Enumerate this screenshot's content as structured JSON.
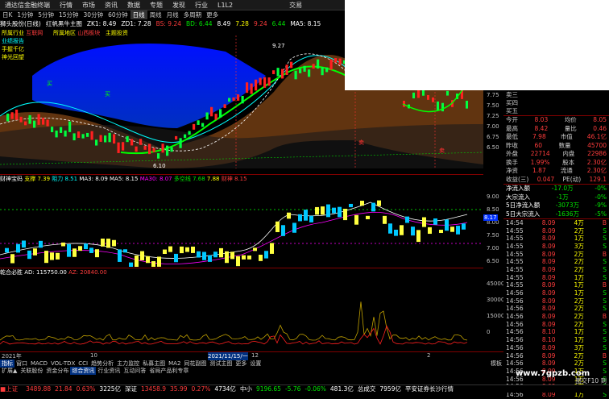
{
  "menu": {
    "logo": "通达信金融终端",
    "items": [
      "行情",
      "市场",
      "资讯",
      "数据",
      "专题",
      "发现",
      "行业",
      "L1L2"
    ],
    "trade": "交易",
    "window_ctrl": "■"
  },
  "timeframes": {
    "items": [
      "日K",
      "1分钟",
      "5分钟",
      "15分钟",
      "30分钟",
      "60分钟",
      "日线",
      "周线",
      "月线",
      "多周期",
      "更多"
    ],
    "active": 6
  },
  "info": {
    "stock": "狮头股份(日线)",
    "indicator": "红帆黑牛主图",
    "zk": "ZK1: 8.49",
    "zd": "ZD1: 7.28",
    "bs": "BS: 9.24",
    "bd": "BD: 6.44",
    "r1": "8.49",
    "r2": "7.28",
    "r3": "9.24",
    "r4": "6.44",
    "ma5": "MA5: 8.15"
  },
  "tags": {
    "industry_lbl": "所属行业",
    "industry": "互联网",
    "region_lbl": "所属地区",
    "region": "山西板块",
    "theme_lbl": "主题投资",
    "t1": "业绩报告",
    "t2": "手握千亿",
    "t3": "神光回望"
  },
  "main_axis": {
    "ticks": [
      "7.75",
      "7.50",
      "7.25",
      "7.00",
      "6.75",
      "6.50"
    ]
  },
  "markers": {
    "buy": "买",
    "sell": "卖",
    "peak": "9.27",
    "low": "6.10"
  },
  "sub1": {
    "name": "财神宝码",
    "zhicheng": "支撑 7.39",
    "yali": "阻力 8.51",
    "ma3": "MA3: 8.09",
    "ma5": "MA5: 8.15",
    "ma30": "MA30: 8.07",
    "extra": "多空线 7.68",
    "extra2": "7.88",
    "extra3": "财神 8.15",
    "axis": [
      "9.00",
      "8.50",
      "8.00",
      "7.50",
      "7.00",
      "6.50"
    ],
    "price_tag": "8.17"
  },
  "sub2": {
    "name": "乾合必胜",
    "ad": "AD: 115750.00",
    "az": "AZ: 20840.00",
    "axis": [
      "45000",
      "30000",
      "15000",
      "0"
    ]
  },
  "dates": {
    "d1": "2021年",
    "d2": "10",
    "d3": "2021/11/15/一",
    "d4": "12",
    "d5": "2"
  },
  "tabs_row1": {
    "items": [
      "指标",
      "窗口",
      "MACD",
      "VOL-TDX",
      "CCI",
      "趋势分析",
      "主力监控",
      "私募主图",
      "MA2",
      "同花副图",
      "测试主图",
      "更多",
      "设置"
    ],
    "active": 0,
    "right": "模板"
  },
  "tabs_row2": {
    "items": [
      "扩展▲",
      "关联股份",
      "资金分布",
      "综合资讯",
      "行业资讯",
      "互动问答",
      "省局产品利专章"
    ],
    "active": 3
  },
  "quote": {
    "sell3_lbl": "卖三",
    "sell4_lbl": "买四",
    "sell5_lbl": "买五",
    "rows": [
      {
        "l": "今开",
        "v": "8.03",
        "l2": "均价",
        "v2": "8.05"
      },
      {
        "l": "最高",
        "v": "8.42",
        "l2": "量比",
        "v2": "0.46"
      },
      {
        "l": "最低",
        "v": "7.98",
        "l2": "市值",
        "v2": "46.1亿"
      },
      {
        "l": "昨收",
        "v": "60",
        "l2": "数量",
        "v2": "45700"
      },
      {
        "l": "外盘",
        "v": "22714",
        "l2": "内盘",
        "v2": "22986"
      },
      {
        "l": "换手",
        "v": "1.99%",
        "l2": "股本",
        "v2": "2.30亿"
      },
      {
        "l": "净资",
        "v": "1.87",
        "l2": "流通",
        "v2": "2.30亿"
      },
      {
        "l": "收益(三)",
        "v": "0.047",
        "l2": "PE(动)",
        "v2": "129.1"
      }
    ],
    "flows": [
      {
        "l": "净流入额",
        "v": "-17.0万",
        "p": "-0%"
      },
      {
        "l": "大宗流入",
        "v": "-1万",
        "p": "-0%"
      },
      {
        "l": "5日净流入额",
        "v": "-3073万",
        "p": "-9%"
      },
      {
        "l": "5日大宗流入",
        "v": "-1636万",
        "p": "-5%"
      }
    ],
    "ticks": [
      {
        "t": "14:54",
        "p": "8.09",
        "v": "4万",
        "d": "B"
      },
      {
        "t": "14:55",
        "p": "8.09",
        "v": "2万",
        "d": "S"
      },
      {
        "t": "14:55",
        "p": "8.09",
        "v": "1万",
        "d": "S"
      },
      {
        "t": "14:55",
        "p": "8.09",
        "v": "3万",
        "d": "S"
      },
      {
        "t": "14:55",
        "p": "8.09",
        "v": "2万",
        "d": "B"
      },
      {
        "t": "14:55",
        "p": "8.09",
        "v": "2万",
        "d": "S"
      },
      {
        "t": "14:55",
        "p": "8.09",
        "v": "2万",
        "d": "S"
      },
      {
        "t": "14:55",
        "p": "8.09",
        "v": "1万",
        "d": "S"
      },
      {
        "t": "14:55",
        "p": "8.09",
        "v": "1万",
        "d": "B"
      },
      {
        "t": "14:56",
        "p": "8.09",
        "v": "1万",
        "d": "S"
      },
      {
        "t": "14:56",
        "p": "8.09",
        "v": "2万",
        "d": "S"
      },
      {
        "t": "14:56",
        "p": "8.09",
        "v": "2万",
        "d": "S"
      },
      {
        "t": "14:56",
        "p": "8.09",
        "v": "2万",
        "d": "B"
      },
      {
        "t": "14:56",
        "p": "8.09",
        "v": "2万",
        "d": "S"
      },
      {
        "t": "14:56",
        "p": "8.10",
        "v": "1万",
        "d": "S"
      },
      {
        "t": "14:56",
        "p": "8.10",
        "v": "1万",
        "d": "S"
      },
      {
        "t": "14:56",
        "p": "8.09",
        "v": "3万",
        "d": "S"
      },
      {
        "t": "14:56",
        "p": "8.09",
        "v": "2万",
        "d": "B"
      },
      {
        "t": "14:56",
        "p": "8.09",
        "v": "2万",
        "d": "S"
      },
      {
        "t": "14:56",
        "p": "8.09",
        "v": "1万",
        "d": "S"
      },
      {
        "t": "14:56",
        "p": "8.09",
        "v": "1万",
        "d": "S"
      },
      {
        "t": "14:56",
        "p": "8.09",
        "v": "1万",
        "d": "S"
      },
      {
        "t": "14:56",
        "p": "8.09",
        "v": "1万",
        "d": "S"
      }
    ],
    "footer": "图交F10 到"
  },
  "status": {
    "sh_lbl": "上证",
    "sh": "3489.88",
    "sh_chg": "21.84",
    "sh_pct": "0.63%",
    "sh_amt": "3225亿",
    "sz_lbl": "深证",
    "sz": "13458.9",
    "sz_chg": "35.99",
    "sz_pct": "0.27%",
    "sz_amt": "4734亿",
    "zx_lbl": "中小",
    "zx": "9196.65",
    "zx_chg": "-5.76",
    "zx_pct": "-0.06%",
    "zx_amt": "481.3亿",
    "total_lbl": "总成交",
    "total": "7959亿",
    "right": "平安证券长沙行情"
  },
  "watermark": "www.7gpzb.com"
}
